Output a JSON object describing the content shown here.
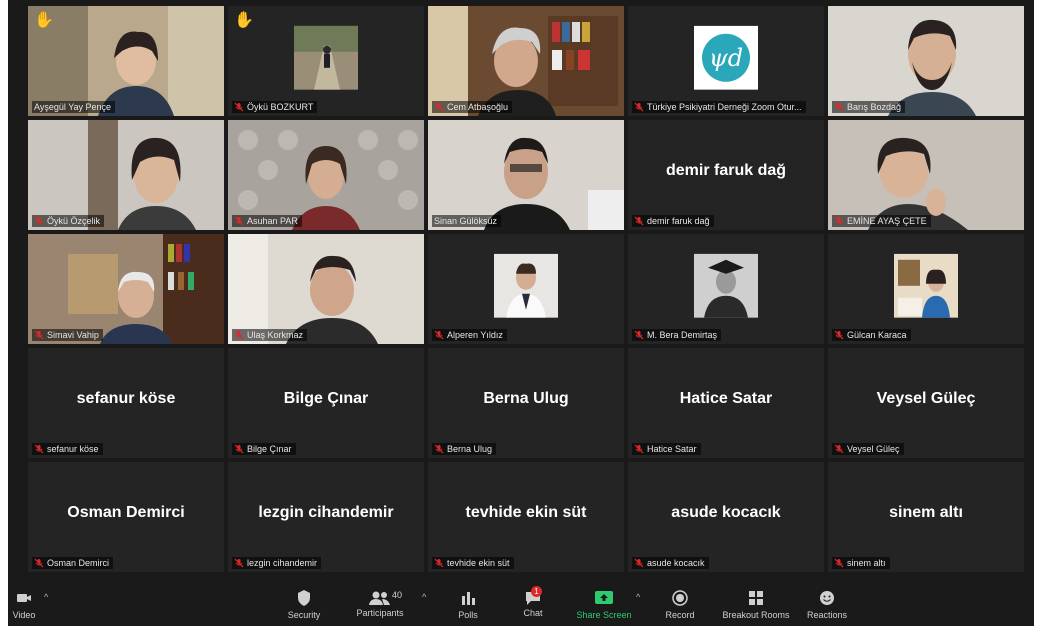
{
  "participants": [
    {
      "name": "Ayşegül Yay Pençe",
      "type": "video",
      "active": true,
      "hand": true,
      "muted": false
    },
    {
      "name": "Öykü BOZKURT",
      "type": "photo",
      "hand": true,
      "muted": true
    },
    {
      "name": "Cem Atbaşoğlu",
      "type": "video",
      "muted": true
    },
    {
      "name": "Türkiye Psikiyatri Derneği Zoom Otur...",
      "type": "logo",
      "muted": true
    },
    {
      "name": "Barış Bozdağ",
      "type": "video",
      "muted": true
    },
    {
      "name": "Öykü Özçelik",
      "type": "video",
      "muted": true
    },
    {
      "name": "Asuhan PAR",
      "type": "video",
      "muted": true
    },
    {
      "name": "Sinan Gülöksüz",
      "type": "video",
      "muted": false
    },
    {
      "name": "demir faruk dağ",
      "type": "name",
      "muted": true
    },
    {
      "name": "EMİNE AYAŞ ÇETE",
      "type": "video",
      "muted": true
    },
    {
      "name": "Simavi Vahip",
      "type": "video",
      "muted": true
    },
    {
      "name": "Ulaş Korkmaz",
      "type": "video",
      "muted": true
    },
    {
      "name": "Alperen Yıldız",
      "type": "photo",
      "muted": true
    },
    {
      "name": "M. Bera Demirtaş",
      "type": "photo",
      "muted": true
    },
    {
      "name": "Gülcan Karaca",
      "type": "photo",
      "muted": true
    },
    {
      "name": "sefanur köse",
      "type": "name",
      "muted": true
    },
    {
      "name": "Bilge Çınar",
      "type": "name",
      "muted": true
    },
    {
      "name": "Berna Ulug",
      "type": "name",
      "muted": true
    },
    {
      "name": "Hatice Satar",
      "type": "name",
      "muted": true
    },
    {
      "name": "Veysel Güleç",
      "type": "name",
      "muted": true
    },
    {
      "name": "Osman Demirci",
      "type": "name",
      "muted": true
    },
    {
      "name": "lezgin cihandemir",
      "type": "name",
      "muted": true
    },
    {
      "name": "tevhide ekin süt",
      "type": "name",
      "muted": true
    },
    {
      "name": "asude kocacık",
      "type": "name",
      "muted": true
    },
    {
      "name": "sinem altı",
      "type": "name",
      "muted": true
    }
  ],
  "toolbar": {
    "video_label": "Video",
    "security_label": "Security",
    "participants_label": "Participants",
    "participants_count": "40",
    "polls_label": "Polls",
    "chat_label": "Chat",
    "chat_badge": "1",
    "share_label": "Share Screen",
    "record_label": "Record",
    "breakout_label": "Breakout Rooms",
    "reactions_label": "Reactions"
  },
  "colors": {
    "background": "#1a1a1a",
    "tile": "#242424",
    "active_border": "#d9d944",
    "mic_muted": "#e02828",
    "share_green": "#2ecc71"
  }
}
